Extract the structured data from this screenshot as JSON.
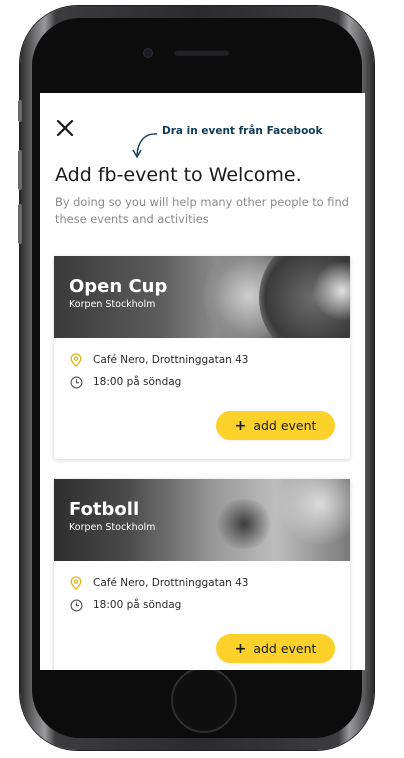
{
  "annotation": "Dra in event från Facebook",
  "header": {
    "title": "Add fb-event to Welcome.",
    "subtitle": "By doing so you will help many other people to find these events and activities"
  },
  "events": [
    {
      "title": "Open Cup",
      "organizer": "Korpen Stockholm",
      "location": "Café Nero, Drottninggatan 43",
      "time": "18:00 på söndag",
      "button_label": "add event"
    },
    {
      "title": "Fotboll",
      "organizer": "Korpen Stockholm",
      "location": "Café Nero, Drottninggatan 43",
      "time": "18:00 på söndag",
      "button_label": "add event"
    }
  ],
  "icons": {
    "close": "close-icon",
    "location": "location-pin-icon",
    "time": "clock-icon",
    "add": "plus-icon"
  },
  "colors": {
    "accent": "#fcd22a",
    "annotation": "#0f3b57",
    "pin": "#e0b21a"
  }
}
